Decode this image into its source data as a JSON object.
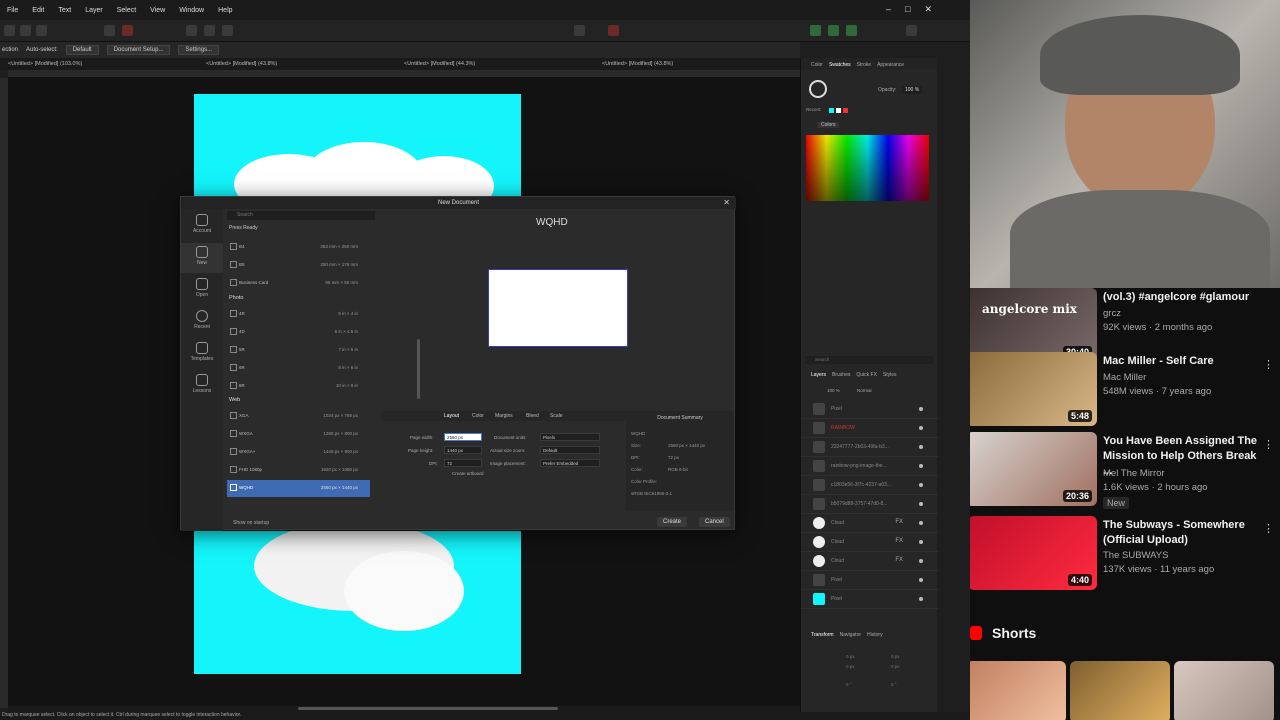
{
  "menu": [
    "File",
    "Edit",
    "Text",
    "Layer",
    "Select",
    "View",
    "Window",
    "Help"
  ],
  "window_controls": [
    "–",
    "□",
    "✕"
  ],
  "context": {
    "selection": "ection",
    "auto_select": "Auto-select:",
    "mode": "Default",
    "doc_setup": "Document Setup...",
    "settings": "Settings..."
  },
  "tabs": [
    "<Untitled> [Modified] (103.0%)",
    "<Untitled> [Modified] (43.8%)",
    "<Untitled> [Modified] (44.3%)",
    "<Untitled> [Modified] (43.8%)"
  ],
  "dialog": {
    "title": "New Document",
    "close": "✕",
    "side": [
      "Account",
      "New",
      "Open",
      "Recent",
      "Templates",
      "Lessons"
    ],
    "search_placeholder": "Search",
    "preset_category": "Press Ready",
    "presets_top": [
      {
        "name": "B4",
        "size": "353 mm × 250 mm"
      },
      {
        "name": "B5",
        "size": "250 mm × 176 mm"
      },
      {
        "name": "Business Card",
        "size": "85 mm × 55 mm"
      }
    ],
    "group_photo": "Photo",
    "presets_photo": [
      {
        "name": "4R",
        "size": "6 in × 4 in"
      },
      {
        "name": "4D",
        "size": "6 in × 4.5 in"
      },
      {
        "name": "5R",
        "size": "7 in × 5 in"
      },
      {
        "name": "6R",
        "size": "8 in × 6 in"
      },
      {
        "name": "8R",
        "size": "10 in × 8 in"
      }
    ],
    "group_web": "Web",
    "presets_web": [
      {
        "name": "XGA",
        "size": "1024 px × 768 px"
      },
      {
        "name": "WXGA",
        "size": "1280 px × 800 px"
      },
      {
        "name": "WXGA+",
        "size": "1440 px × 900 px"
      },
      {
        "name": "FHD 1080p",
        "size": "1920 px × 1080 px"
      },
      {
        "name": "WQHD",
        "size": "2560 px × 1440 px"
      }
    ],
    "preview_title": "WQHD",
    "option_tabs": [
      "Layout",
      "Color",
      "Margins",
      "Bleed",
      "Scale"
    ],
    "page_width_label": "Page width:",
    "page_width": "2560 px",
    "page_height_label": "Page height:",
    "page_height": "1440 px",
    "dpi_label": "DPI:",
    "dpi": "72",
    "create_artboard": "Create artboard",
    "doc_units_label": "Document units:",
    "doc_units": "Pixels",
    "actual_zoom_label": "Actual size zoom:",
    "actual_zoom": "Default",
    "image_placement_label": "Image placement:",
    "image_placement": "Prefer Embedded",
    "summary_title": "Document Summary",
    "summary": {
      "name": "WQHD",
      "size_label": "Size:",
      "size": "2560 px × 1440 px",
      "dpi_label": "DPI:",
      "dpi": "72 px",
      "color_label": "Color:",
      "color": "RGB 8-bit",
      "profile_label": "Color Profile:",
      "profile": "sRGB IEC61966-2.1"
    },
    "show_startup": "Show on startup",
    "create": "Create",
    "cancel": "Cancel"
  },
  "panel": {
    "tabs": [
      "Color",
      "Swatches",
      "Stroke",
      "Appearance"
    ],
    "opacity_label": "Opacity:",
    "opacity": "100 %",
    "recent_label": "Recent:",
    "colors_label": "Colors",
    "search_placeholder": "Search",
    "layer_tabs": [
      "Layers",
      "Brushes",
      "Quick FX",
      "Styles"
    ],
    "opacity2": "100 %",
    "blend": "Normal",
    "layers": [
      {
        "name": "Pixel",
        "fx": ""
      },
      {
        "name": "RAINBOW",
        "fx": ""
      },
      {
        "name": "23247777-2b03-49fa-b3...",
        "fx": ""
      },
      {
        "name": "rainbow-png-image-the...",
        "fx": ""
      },
      {
        "name": "c1803e56-3f7c-4237-a03...",
        "fx": ""
      },
      {
        "name": "b5079d88-3757-47d0-8...",
        "fx": ""
      },
      {
        "name": "Cloud",
        "fx": "FX"
      },
      {
        "name": "Cloud",
        "fx": "FX"
      },
      {
        "name": "Cloud",
        "fx": "FX"
      },
      {
        "name": "Pixel",
        "fx": ""
      },
      {
        "name": "Pixel",
        "fx": ""
      }
    ],
    "bottom_tabs": [
      "Transform",
      "Navigator",
      "History"
    ],
    "transform": {
      "x": "0 px",
      "y": "0 px",
      "w": "0 px",
      "h": "0 px",
      "r": "0 °",
      "s": "0 °"
    }
  },
  "status": "Drag to marquee select. Click an object to select it. Ctrl during marquee select to toggle interaction behavior.",
  "youtube": {
    "videos": [
      {
        "title": "(vol.3) #angelcore #glamour",
        "channel": "grcz",
        "meta": "92K views · 2 months ago",
        "duration": "30:40",
        "thumb_text": "angelcore mix",
        "badge": ""
      },
      {
        "title": "Mac Miller - Self Care",
        "channel": "Mac Miller",
        "meta": "548M views · 7 years ago",
        "duration": "5:48",
        "thumb_text": "",
        "badge": ""
      },
      {
        "title": "You Have Been Assigned The Mission to Help Others Break ...",
        "channel": "Mel The Mirror",
        "meta": "1.6K views · 2 hours ago",
        "duration": "20:36",
        "thumb_text": "",
        "badge": "New"
      },
      {
        "title": "The Subways - Somewhere (Official Upload)",
        "channel": "The SUBWAYS",
        "meta": "137K views · 11 years ago",
        "duration": "4:40",
        "thumb_text": "",
        "badge": ""
      }
    ],
    "shorts_label": "Shorts"
  },
  "colors": {
    "accent": "#3f6bb5",
    "canvas_cyan": "#13f4fb",
    "yt_bg": "#0f0f0f"
  }
}
